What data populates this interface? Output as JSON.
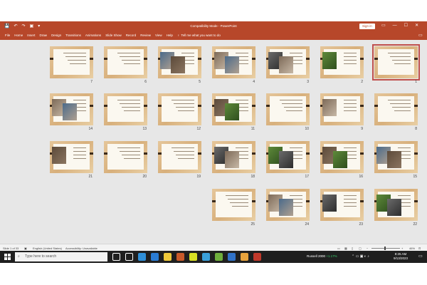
{
  "window": {
    "title": "Compatibility Mode - PowerPoint",
    "signin_label": "Sign in",
    "qat": [
      "💾",
      "↶",
      "↷",
      "▣",
      "▾"
    ],
    "controls": [
      "▭",
      "—",
      "☐",
      "✕"
    ]
  },
  "ribbon": {
    "tabs": [
      "File",
      "Home",
      "Insert",
      "Draw",
      "Design",
      "Transitions",
      "Animations",
      "Slide Show",
      "Record",
      "Review",
      "View",
      "Help"
    ],
    "tell_icon": "lightbulb-icon",
    "tell_me": "Tell me what you want to do",
    "comments_icon": "comment-icon"
  },
  "sorter": {
    "selected_slide": "1",
    "slides": [
      {
        "n": "1",
        "pics": 0,
        "sel": true
      },
      {
        "n": "2",
        "pics": 1
      },
      {
        "n": "3",
        "pics": 2
      },
      {
        "n": "4",
        "pics": 2
      },
      {
        "n": "5",
        "pics": 2
      },
      {
        "n": "6",
        "pics": 0
      },
      {
        "n": "7",
        "pics": 0
      },
      {
        "n": "8",
        "pics": 0
      },
      {
        "n": "9",
        "pics": 1
      },
      {
        "n": "10",
        "pics": 0
      },
      {
        "n": "11",
        "pics": 2
      },
      {
        "n": "12",
        "pics": 0
      },
      {
        "n": "13",
        "pics": 0
      },
      {
        "n": "14",
        "pics": 2
      },
      {
        "n": "15",
        "pics": 2
      },
      {
        "n": "16",
        "pics": 2
      },
      {
        "n": "17",
        "pics": 2
      },
      {
        "n": "18",
        "pics": 2
      },
      {
        "n": "19",
        "pics": 0
      },
      {
        "n": "20",
        "pics": 0
      },
      {
        "n": "21",
        "pics": 1
      },
      {
        "n": "22",
        "pics": 2
      },
      {
        "n": "23",
        "pics": 1
      },
      {
        "n": "24",
        "pics": 2
      },
      {
        "n": "25",
        "pics": 0
      }
    ]
  },
  "status": {
    "slide_of": "Slide 1 of 33",
    "language": "English (United States)",
    "accessibility": "Accessibility: Unavailable",
    "zoom": "46%"
  },
  "taskbar": {
    "search_placeholder": "Type here to search",
    "stock_name": "Russell 2000",
    "stock_change": "+1.17%",
    "time": "8:25 AM",
    "date": "9/13/2023",
    "app_colors": [
      "#ffffff",
      "#ffffff",
      "#2f8fd8",
      "#2b7cd3",
      "#f0c93a",
      "#c95a2a",
      "#d9e023",
      "#3aa0d8",
      "#6fae3c",
      "#3072c8",
      "#e8a33c",
      "#c0392b"
    ]
  },
  "colors": {
    "accent": "#b7472a",
    "selection": "#c0504d",
    "slide_bg": "#e5c69a"
  }
}
